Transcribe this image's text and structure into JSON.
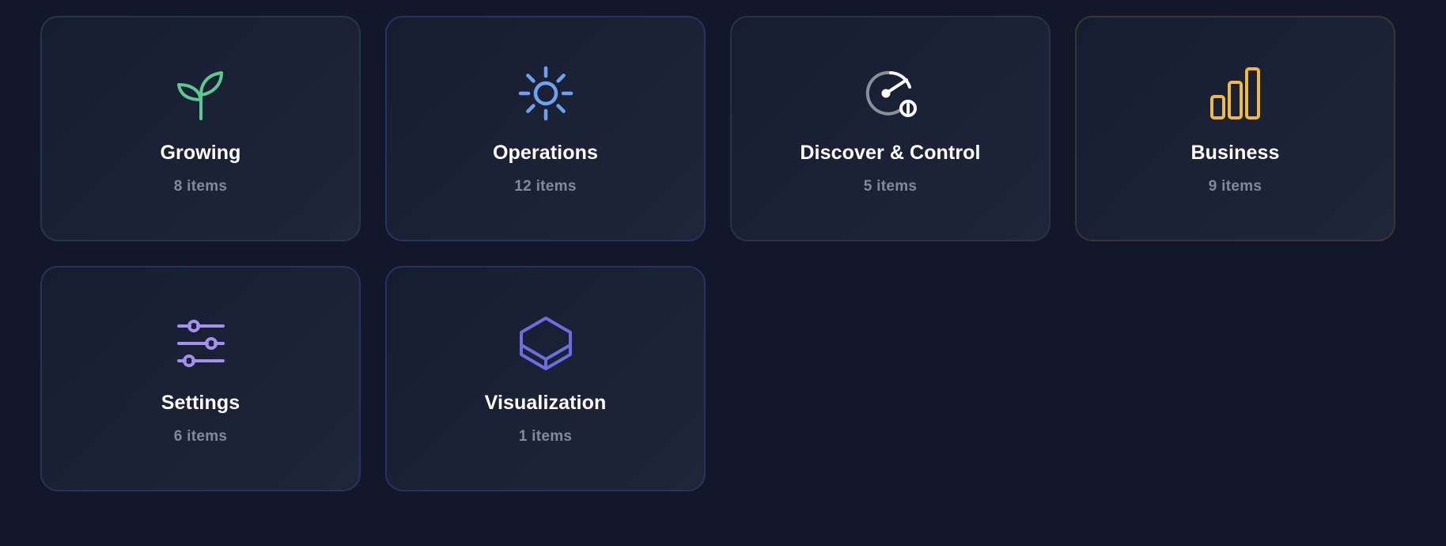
{
  "categories": [
    {
      "title": "Growing",
      "count": "8 items",
      "icon": "sprout-icon",
      "color": "#5ec98e",
      "border": "#20394a"
    },
    {
      "title": "Operations",
      "count": "12 items",
      "icon": "sun-icon",
      "color": "#6ea1f0",
      "border": "#233560"
    },
    {
      "title": "Discover & Control",
      "count": "5 items",
      "icon": "gauge-icon",
      "color": "#ffffff",
      "border": "#283248"
    },
    {
      "title": "Business",
      "count": "9 items",
      "icon": "bar-chart-icon",
      "color": "#f0b941",
      "border": "#3a3730"
    },
    {
      "title": "Settings",
      "count": "6 items",
      "icon": "sliders-icon",
      "color": "#a690ef",
      "border": "#293258"
    },
    {
      "title": "Visualization",
      "count": "1 items",
      "icon": "cube-icon",
      "color": "#6d6ce0",
      "border": "#283260"
    }
  ]
}
